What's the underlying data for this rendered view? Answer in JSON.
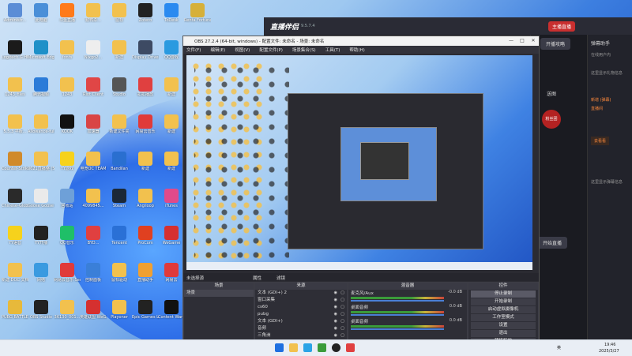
{
  "desktop_icons": [
    {
      "label": "Administr...",
      "color": "#5b8dd6"
    },
    {
      "label": "Logitech G HUB",
      "color": "#1b1b1b"
    },
    {
      "label": "1243_files",
      "color": "#f2c14e"
    },
    {
      "label": "5.5.3 平板...",
      "color": "#f2c14e"
    },
    {
      "label": "Counter-Strike 2 GO",
      "color": "#d08a2b"
    },
    {
      "label": "Chinese-Global Off...",
      "color": "#2a2a2a"
    },
    {
      "label": "YY语音",
      "color": "#f6d21c"
    },
    {
      "label": "新建 DOC 文档",
      "color": "#f2c14e"
    },
    {
      "label": "PUBG BATTLEGR...",
      "color": "#e7b93b"
    },
    {
      "label": "此电脑",
      "color": "#4a8fd8"
    },
    {
      "label": "Microsoft Edge",
      "color": "#1e90c8"
    },
    {
      "label": "腾讯视频",
      "color": "#2b7bd8"
    },
    {
      "label": "Allowance-full",
      "color": "#f2c14e"
    },
    {
      "label": "0621直播整 (558)",
      "color": "#f2c14e"
    },
    {
      "label": "Goose Goose Duck",
      "color": "#eaeaea"
    },
    {
      "label": "YY开播",
      "color": "#222"
    },
    {
      "label": "网络",
      "color": "#3a9ae0"
    },
    {
      "label": "OBS Studio",
      "color": "#222"
    },
    {
      "label": "斗鱼直播",
      "color": "#ff7a1a"
    },
    {
      "label": "fonts",
      "color": "#f2c14e"
    },
    {
      "label": "1243",
      "color": "#f2c14e"
    },
    {
      "label": "KOOK",
      "color": "#111"
    },
    {
      "label": "YY游戏",
      "color": "#f6d21c"
    },
    {
      "label": "回收站",
      "color": "#6ea0d8"
    },
    {
      "label": "QQ音乐",
      "color": "#1fbf68"
    },
    {
      "label": "网易云音乐 Sequola 12",
      "color": "#e03a3a"
    },
    {
      "label": "36130_001...",
      "color": "#f2c14e"
    },
    {
      "label": "鹅鸭杀...",
      "color": "#f2c14e"
    },
    {
      "label": "Nixgo2...",
      "color": "#eee"
    },
    {
      "label": "Riot Client",
      "color": "#e04646"
    },
    {
      "label": "加速器",
      "color": "#d94545"
    },
    {
      "label": "电竞OC TEAM",
      "color": "#f2c14e"
    },
    {
      "label": "4099845...",
      "color": "#f2c14e"
    },
    {
      "label": "BYD...",
      "color": "#e04040"
    },
    {
      "label": "控制面板",
      "color": "#3a7fd8"
    },
    {
      "label": "英雄联盟 WeGame",
      "color": "#d53030"
    },
    {
      "label": "鼠标",
      "color": "#f2c14e"
    },
    {
      "label": "新建",
      "color": "#f2c14e"
    },
    {
      "label": "Studio",
      "color": "#555"
    },
    {
      "label": "新建文件夹",
      "color": "#f2c14e"
    },
    {
      "label": "Bandilan",
      "color": "#2a6fd0"
    },
    {
      "label": "Steam",
      "color": "#1b2838"
    },
    {
      "label": "Tencent",
      "color": "#2a70d6"
    },
    {
      "label": "鼠标驱动",
      "color": "#f2c14e"
    },
    {
      "label": "Playoner",
      "color": "#f2c14e"
    },
    {
      "label": "Zotero",
      "color": "#222"
    },
    {
      "label": "Display Driver U...",
      "color": "#3d4a63"
    },
    {
      "label": "扣扣播放",
      "color": "#e04040"
    },
    {
      "label": "网易云音乐",
      "color": "#e03a3a"
    },
    {
      "label": "新建",
      "color": "#f2c14e"
    },
    {
      "label": "Angiloop",
      "color": "#f2c14e"
    },
    {
      "label": "ProCom",
      "color": "#e04020"
    },
    {
      "label": "直播助手",
      "color": "#f0a030"
    },
    {
      "label": "Epic Games Launcher",
      "color": "#222"
    },
    {
      "label": "ToDesk",
      "color": "#2a8af0"
    },
    {
      "label": "QQ游戏",
      "color": "#2a9ae0"
    },
    {
      "label": "新建",
      "color": "#f2c14e"
    },
    {
      "label": "新建",
      "color": "#f2c14e"
    },
    {
      "label": "新建",
      "color": "#f2c14e"
    },
    {
      "label": "iTunes",
      "color": "#e04a8a"
    },
    {
      "label": "WeGame",
      "color": "#d53030"
    },
    {
      "label": "网易云",
      "color": "#e03a3a"
    },
    {
      "label": "Content Warning",
      "color": "#111"
    },
    {
      "label": "Renta Fortune",
      "color": "#d6b03a"
    },
    {
      "label": "鹅鸭",
      "color": "#20c060"
    },
    {
      "label": "TeamSpeak 3",
      "color": "#2a4a9a"
    }
  ],
  "streaming_app": {
    "logo": "直播伴侣",
    "version": "9.5.7.4",
    "live_label": "主播直播",
    "guide": "开播攻略",
    "notice_title": "弹幕助手",
    "notice_text": "在线用户内",
    "side_text_1": "送图",
    "side_text_2": "这里显示礼物信息",
    "side_text_3": "新增 (弹幕)",
    "side_text_4": "直播间",
    "link_text": "去看看",
    "start_button": "开始直播",
    "stat_rate": "粉丝团",
    "side_text_5": "这里显示弹幕信息"
  },
  "obs": {
    "title": "OBS 27.2.4 (64-bit, windows) - 配置文件: 未命名 - 场景: 未命名",
    "menu": [
      "文件(F)",
      "编辑(E)",
      "视图(V)",
      "配置文件(P)",
      "场景集合(S)",
      "工具(T)",
      "帮助(H)"
    ],
    "scene_label": "未选择源",
    "tab_properties": "属性",
    "tab_filters": "滤镜",
    "scenes_header": "场景",
    "sources_header": "来源",
    "mixer_header": "混音器",
    "controls_header": "控件",
    "scenes": [
      "场景"
    ],
    "sources": [
      {
        "name": "文本 (GDI+) 2"
      },
      {
        "name": "窗口采集"
      },
      {
        "name": "cs60"
      },
      {
        "name": "pubg"
      },
      {
        "name": "文本 (GDI+)"
      },
      {
        "name": "音频"
      },
      {
        "name": "三角洲"
      },
      {
        "name": "窗口采集"
      },
      {
        "name": "窗口采集"
      }
    ],
    "mixer": [
      {
        "name": "麦克风/Aux",
        "db": "-0.0 dB"
      },
      {
        "name": "桌面音频",
        "db": "0.0 dB"
      },
      {
        "name": "桌面音频",
        "db": "0.0 dB"
      }
    ],
    "controls": [
      "停止录制",
      "开始录制",
      "启动虚拟摄像机",
      "工作室模式",
      "设置",
      "退出",
      "转场特效"
    ]
  },
  "taskbar": {
    "time": "19:46",
    "date": "2025/3/27",
    "lang": "英"
  }
}
